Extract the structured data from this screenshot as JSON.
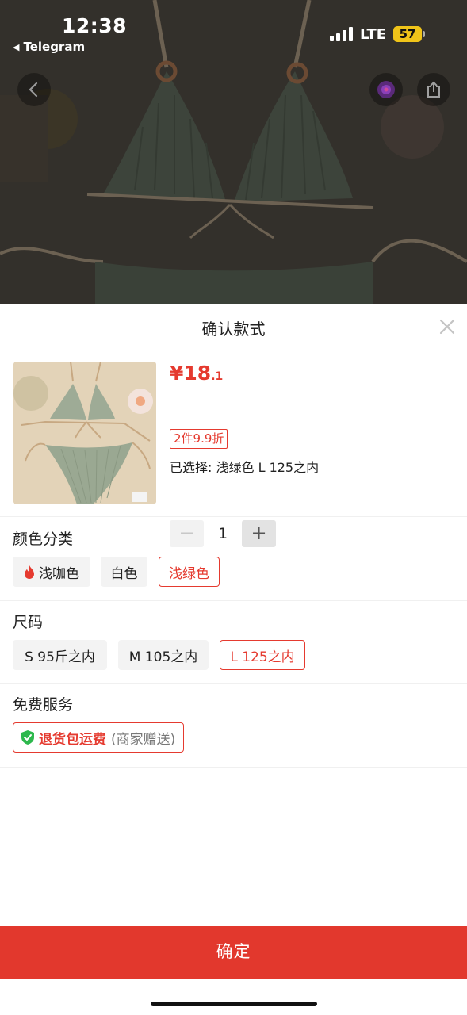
{
  "status_bar": {
    "time": "12:38",
    "back_app": "Telegram",
    "network": "LTE",
    "battery": "57"
  },
  "sheet": {
    "title": "确认款式"
  },
  "product": {
    "price_main": "¥18",
    "price_decimal": ".1",
    "promo": "2件9.9折",
    "selected_text": "已选择: 浅绿色 L 125之内",
    "quantity": "1",
    "minus_label": "−",
    "plus_label": "+"
  },
  "color": {
    "title": "颜色分类",
    "options": [
      "浅咖色",
      "白色",
      "浅绿色"
    ],
    "selected": "浅绿色"
  },
  "size": {
    "title": "尺码",
    "options": [
      "S 95斤之内",
      "M 105之内",
      "L 125之内"
    ],
    "selected": "L 125之内"
  },
  "service": {
    "title": "免费服务",
    "main": "退货包运费",
    "sub": "(商家赠送)"
  },
  "confirm_label": "确定",
  "colors": {
    "accent": "#e53a2f",
    "confirm_bg": "#e2382d",
    "battery": "#f0c419",
    "product_green": "#8a9a86"
  }
}
